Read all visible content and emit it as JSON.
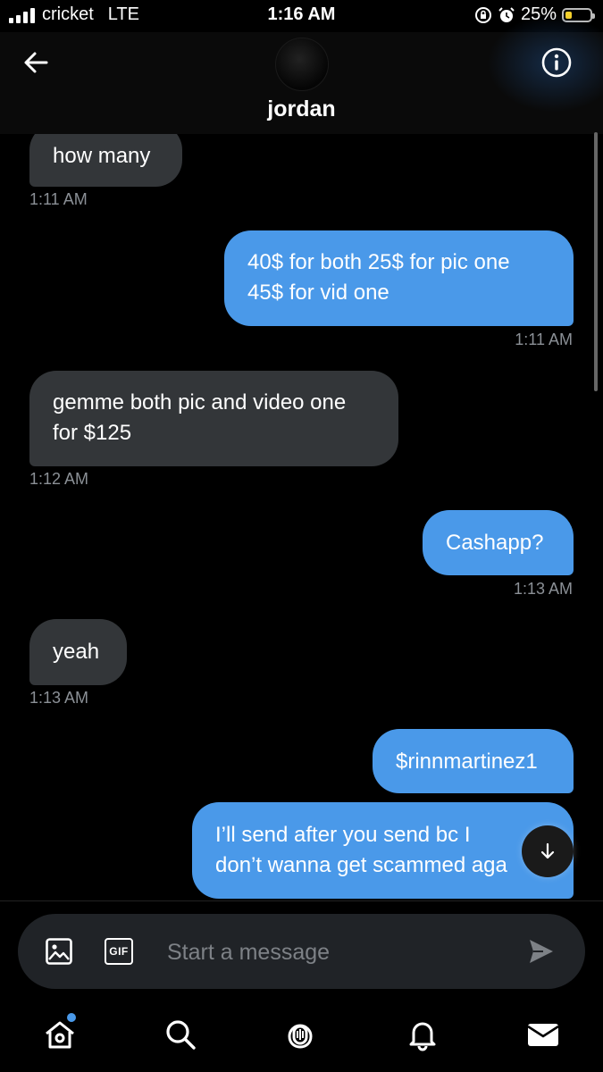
{
  "status_bar": {
    "carrier": "cricket",
    "network": "LTE",
    "time": "1:16 AM",
    "battery": "25%",
    "battery_level": 0.25
  },
  "header": {
    "contact_name": "jordan"
  },
  "messages": [
    {
      "direction": "in",
      "text": "how many",
      "time": "1:11 AM"
    },
    {
      "direction": "out",
      "text": "40$ for both 25$ for pic one 45$ for vid one",
      "line1": "40$ for both 25$ for pic one",
      "line2": "45$ for vid one",
      "time": "1:11 AM"
    },
    {
      "direction": "in",
      "text": "gemme both pic and video one for $125",
      "line1": "gemme both pic and video one",
      "line2": "for $125",
      "time": "1:12 AM"
    },
    {
      "direction": "out",
      "text": "Cashapp?",
      "time": "1:13 AM"
    },
    {
      "direction": "in",
      "text": "yeah",
      "time": "1:13 AM"
    },
    {
      "direction": "out",
      "text": "$rinnmartinez1"
    },
    {
      "direction": "out",
      "text": "I’ll send after you send bc I don’t wanna get scammed aga",
      "line1": "I’ll send after you send bc I",
      "line2": "don’t wanna get scammed aga"
    }
  ],
  "composer": {
    "placeholder": "Start a message",
    "gif_label": "GIF"
  },
  "colors": {
    "outgoing_bubble": "#4a99e9",
    "incoming_bubble": "#333639",
    "background": "#000000"
  },
  "tabs": [
    "home-icon",
    "search-icon",
    "spaces-icon",
    "notifications-icon",
    "messages-icon"
  ]
}
